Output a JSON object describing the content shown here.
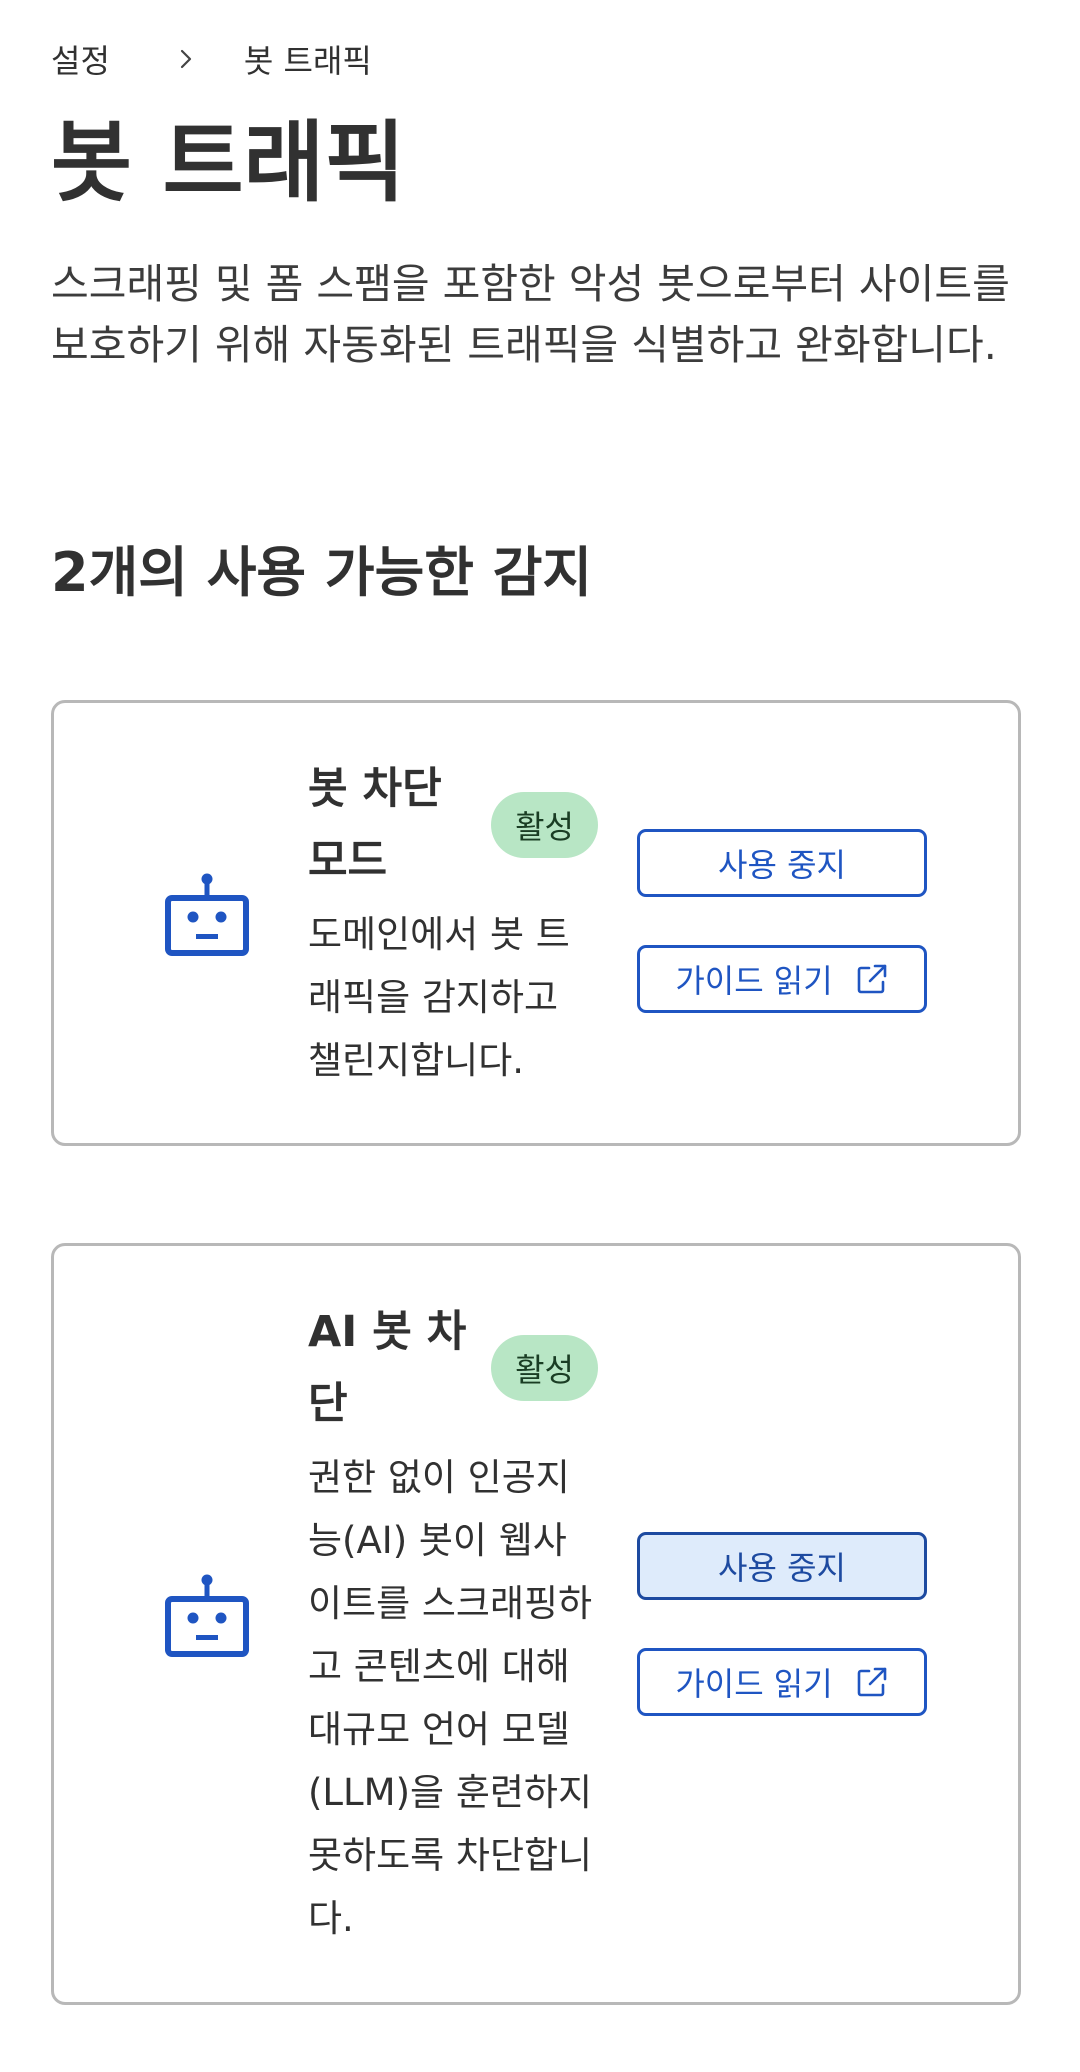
{
  "breadcrumb": {
    "parent": "설정",
    "current": "봇 트래픽"
  },
  "page": {
    "title": "봇 트래픽",
    "description": "스크래핑 및 폼 스팸을 포함한 악성 봇으로부터 사이트를 보호하기 위해 자동화된 트래픽을 식별하고 완화합니다."
  },
  "section": {
    "title": "2개의 사용 가능한 감지"
  },
  "cards": [
    {
      "title": "봇 차단 모드",
      "badge": "활성",
      "description": "도메인에서 봇 트래픽을 감지하고 챌린지합니다.",
      "stop_label": "사용 중지",
      "guide_label": "가이드 읽기",
      "icon": "robot-icon"
    },
    {
      "title": "AI 봇 차단",
      "badge": "활성",
      "description": "권한 없이 인공지능(AI) 봇이 웹사이트를 스크래핑하고 콘텐츠에 대해 대규모 언어 모델(LLM)을 훈련하지 못하도록 차단합니다.",
      "stop_label": "사용 중지",
      "guide_label": "가이드 읽기",
      "icon": "robot-icon"
    }
  ],
  "colors": {
    "accent": "#1f55c2",
    "badge_bg": "#b8e6c5",
    "pressed_bg": "#deebfb",
    "card_border": "#b8b8b8"
  }
}
